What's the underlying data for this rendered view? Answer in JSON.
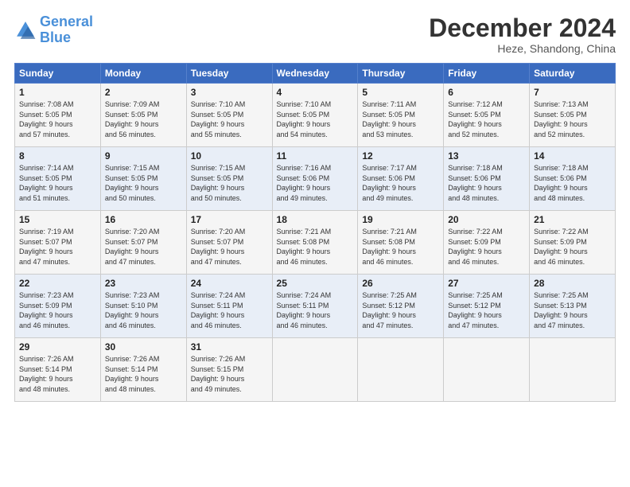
{
  "logo": {
    "line1": "General",
    "line2": "Blue"
  },
  "title": "December 2024",
  "location": "Heze, Shandong, China",
  "weekdays": [
    "Sunday",
    "Monday",
    "Tuesday",
    "Wednesday",
    "Thursday",
    "Friday",
    "Saturday"
  ],
  "weeks": [
    [
      {
        "day": "1",
        "info": "Sunrise: 7:08 AM\nSunset: 5:05 PM\nDaylight: 9 hours\nand 57 minutes."
      },
      {
        "day": "2",
        "info": "Sunrise: 7:09 AM\nSunset: 5:05 PM\nDaylight: 9 hours\nand 56 minutes."
      },
      {
        "day": "3",
        "info": "Sunrise: 7:10 AM\nSunset: 5:05 PM\nDaylight: 9 hours\nand 55 minutes."
      },
      {
        "day": "4",
        "info": "Sunrise: 7:10 AM\nSunset: 5:05 PM\nDaylight: 9 hours\nand 54 minutes."
      },
      {
        "day": "5",
        "info": "Sunrise: 7:11 AM\nSunset: 5:05 PM\nDaylight: 9 hours\nand 53 minutes."
      },
      {
        "day": "6",
        "info": "Sunrise: 7:12 AM\nSunset: 5:05 PM\nDaylight: 9 hours\nand 52 minutes."
      },
      {
        "day": "7",
        "info": "Sunrise: 7:13 AM\nSunset: 5:05 PM\nDaylight: 9 hours\nand 52 minutes."
      }
    ],
    [
      {
        "day": "8",
        "info": "Sunrise: 7:14 AM\nSunset: 5:05 PM\nDaylight: 9 hours\nand 51 minutes."
      },
      {
        "day": "9",
        "info": "Sunrise: 7:15 AM\nSunset: 5:05 PM\nDaylight: 9 hours\nand 50 minutes."
      },
      {
        "day": "10",
        "info": "Sunrise: 7:15 AM\nSunset: 5:05 PM\nDaylight: 9 hours\nand 50 minutes."
      },
      {
        "day": "11",
        "info": "Sunrise: 7:16 AM\nSunset: 5:06 PM\nDaylight: 9 hours\nand 49 minutes."
      },
      {
        "day": "12",
        "info": "Sunrise: 7:17 AM\nSunset: 5:06 PM\nDaylight: 9 hours\nand 49 minutes."
      },
      {
        "day": "13",
        "info": "Sunrise: 7:18 AM\nSunset: 5:06 PM\nDaylight: 9 hours\nand 48 minutes."
      },
      {
        "day": "14",
        "info": "Sunrise: 7:18 AM\nSunset: 5:06 PM\nDaylight: 9 hours\nand 48 minutes."
      }
    ],
    [
      {
        "day": "15",
        "info": "Sunrise: 7:19 AM\nSunset: 5:07 PM\nDaylight: 9 hours\nand 47 minutes."
      },
      {
        "day": "16",
        "info": "Sunrise: 7:20 AM\nSunset: 5:07 PM\nDaylight: 9 hours\nand 47 minutes."
      },
      {
        "day": "17",
        "info": "Sunrise: 7:20 AM\nSunset: 5:07 PM\nDaylight: 9 hours\nand 47 minutes."
      },
      {
        "day": "18",
        "info": "Sunrise: 7:21 AM\nSunset: 5:08 PM\nDaylight: 9 hours\nand 46 minutes."
      },
      {
        "day": "19",
        "info": "Sunrise: 7:21 AM\nSunset: 5:08 PM\nDaylight: 9 hours\nand 46 minutes."
      },
      {
        "day": "20",
        "info": "Sunrise: 7:22 AM\nSunset: 5:09 PM\nDaylight: 9 hours\nand 46 minutes."
      },
      {
        "day": "21",
        "info": "Sunrise: 7:22 AM\nSunset: 5:09 PM\nDaylight: 9 hours\nand 46 minutes."
      }
    ],
    [
      {
        "day": "22",
        "info": "Sunrise: 7:23 AM\nSunset: 5:09 PM\nDaylight: 9 hours\nand 46 minutes."
      },
      {
        "day": "23",
        "info": "Sunrise: 7:23 AM\nSunset: 5:10 PM\nDaylight: 9 hours\nand 46 minutes."
      },
      {
        "day": "24",
        "info": "Sunrise: 7:24 AM\nSunset: 5:11 PM\nDaylight: 9 hours\nand 46 minutes."
      },
      {
        "day": "25",
        "info": "Sunrise: 7:24 AM\nSunset: 5:11 PM\nDaylight: 9 hours\nand 46 minutes."
      },
      {
        "day": "26",
        "info": "Sunrise: 7:25 AM\nSunset: 5:12 PM\nDaylight: 9 hours\nand 47 minutes."
      },
      {
        "day": "27",
        "info": "Sunrise: 7:25 AM\nSunset: 5:12 PM\nDaylight: 9 hours\nand 47 minutes."
      },
      {
        "day": "28",
        "info": "Sunrise: 7:25 AM\nSunset: 5:13 PM\nDaylight: 9 hours\nand 47 minutes."
      }
    ],
    [
      {
        "day": "29",
        "info": "Sunrise: 7:26 AM\nSunset: 5:14 PM\nDaylight: 9 hours\nand 48 minutes."
      },
      {
        "day": "30",
        "info": "Sunrise: 7:26 AM\nSunset: 5:14 PM\nDaylight: 9 hours\nand 48 minutes."
      },
      {
        "day": "31",
        "info": "Sunrise: 7:26 AM\nSunset: 5:15 PM\nDaylight: 9 hours\nand 49 minutes."
      },
      {
        "day": "",
        "info": ""
      },
      {
        "day": "",
        "info": ""
      },
      {
        "day": "",
        "info": ""
      },
      {
        "day": "",
        "info": ""
      }
    ]
  ]
}
